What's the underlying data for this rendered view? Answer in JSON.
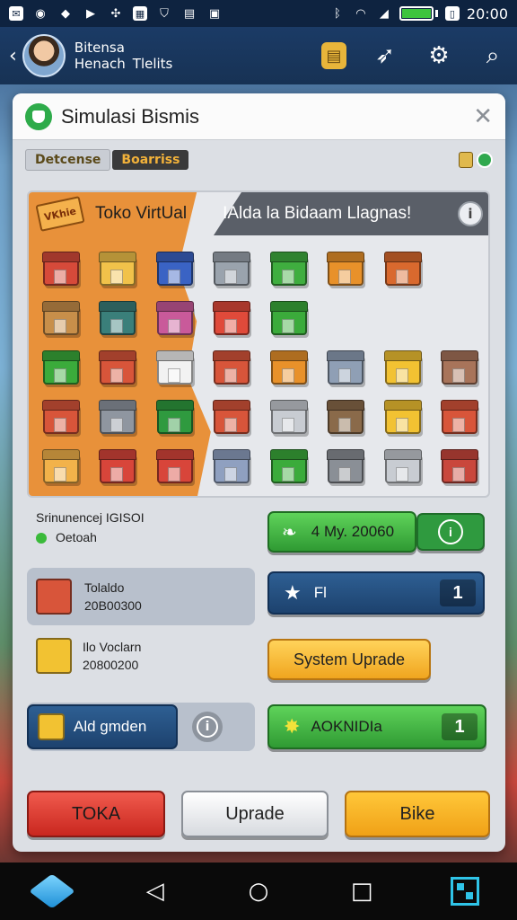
{
  "status_bar": {
    "time": "20:00",
    "battery_level": 1.0,
    "left_icons": [
      "mail-icon",
      "circle-icon",
      "leaf-icon",
      "arrows-icon",
      "map-icon",
      "shield-icon",
      "calendar-icon",
      "grid-icon"
    ],
    "right_icons": [
      "bluetooth-icon",
      "wifi-icon",
      "signal-icon",
      "battery-icon",
      "sim-icon"
    ]
  },
  "app_header": {
    "user_line1": "Bitensa",
    "user_line2": "Henach",
    "user_line3": "Tlelits",
    "actions": [
      "scroll-icon",
      "rocket-icon",
      "gear-icon",
      "search-icon"
    ]
  },
  "dialog": {
    "title": "Simulasi Bismis",
    "close_label": "✕",
    "tabs": [
      "Detcense",
      "Boarriss"
    ],
    "store": {
      "badge": "VKhie",
      "title_left": "Toko VirtUal",
      "title_right": "IAlda la Bidaam Llagnas!",
      "info": "i"
    },
    "stats": {
      "label": "Srinunencej IGISOI",
      "sub": "Oetoah",
      "money_button": "4 My. 20060",
      "money_info": "i"
    },
    "left_panels": [
      {
        "title": "Tolaldo",
        "value": "20B00300"
      },
      {
        "title": "Ilo Voclarn",
        "value": "20800200"
      },
      {
        "title": "Ald gmden",
        "info": "i"
      }
    ],
    "right_buttons": [
      {
        "label": "Fl",
        "count": "1"
      },
      {
        "label": "System Uprade"
      },
      {
        "label": "AOKNIDIa",
        "count": "1"
      }
    ],
    "bottom_buttons": [
      "TOKA",
      "Uprade",
      "Bike"
    ]
  },
  "colors": {
    "accent_orange": "#e8913a",
    "header_blue": "#173254",
    "green": "#2f9a33",
    "blue": "#1d426e",
    "yellow": "#f0a51f",
    "red": "#c9271f"
  },
  "store_items": [
    {
      "name": "shop",
      "color": "#d64a3a"
    },
    {
      "name": "truck",
      "color": "#f1c24a"
    },
    {
      "name": "van",
      "color": "#3a63c4"
    },
    {
      "name": "machine",
      "color": "#9aa3ad"
    },
    {
      "name": "truck",
      "color": "#3fae3f"
    },
    {
      "name": "stand",
      "color": "#e8912a"
    },
    {
      "name": "basket",
      "color": "#d9692e"
    },
    {
      "name": "empty",
      "color": ""
    },
    {
      "name": "box",
      "color": "#c88f4a"
    },
    {
      "name": "shop",
      "color": "#3a7f7a"
    },
    {
      "name": "van",
      "color": "#c95a9a"
    },
    {
      "name": "house",
      "color": "#e04a3a"
    },
    {
      "name": "truck",
      "color": "#3bab3b"
    },
    {
      "name": "empty",
      "color": ""
    },
    {
      "name": "empty",
      "color": ""
    },
    {
      "name": "empty",
      "color": ""
    },
    {
      "name": "crate",
      "color": "#3bab3b"
    },
    {
      "name": "shop",
      "color": "#d8553a"
    },
    {
      "name": "printer",
      "color": "#f2f2f2"
    },
    {
      "name": "stall",
      "color": "#d8553a"
    },
    {
      "name": "cart",
      "color": "#e8912a"
    },
    {
      "name": "trolley",
      "color": "#8f9fb5"
    },
    {
      "name": "basket",
      "color": "#f2c232"
    },
    {
      "name": "crate",
      "color": "#a8745a"
    },
    {
      "name": "house",
      "color": "#d8553a"
    },
    {
      "name": "machine",
      "color": "#8f96a0"
    },
    {
      "name": "store",
      "color": "#2f9a3f"
    },
    {
      "name": "shop",
      "color": "#d8553a"
    },
    {
      "name": "car",
      "color": "#c8ccd2"
    },
    {
      "name": "cart",
      "color": "#8a6a4a"
    },
    {
      "name": "basket",
      "color": "#f2c232"
    },
    {
      "name": "truck",
      "color": "#d8553a"
    },
    {
      "name": "box",
      "color": "#f2b24a"
    },
    {
      "name": "truck",
      "color": "#d8453a"
    },
    {
      "name": "truck",
      "color": "#d8453a"
    },
    {
      "name": "trolley",
      "color": "#8fa0c0"
    },
    {
      "name": "trolley",
      "color": "#3bab3b"
    },
    {
      "name": "trolley",
      "color": "#8a8f96"
    },
    {
      "name": "car",
      "color": "#c8ccd2"
    },
    {
      "name": "car",
      "color": "#c9473c"
    }
  ],
  "navbar": [
    "app-cube-icon",
    "back-icon",
    "home-icon",
    "recents-icon",
    "qr-icon"
  ]
}
